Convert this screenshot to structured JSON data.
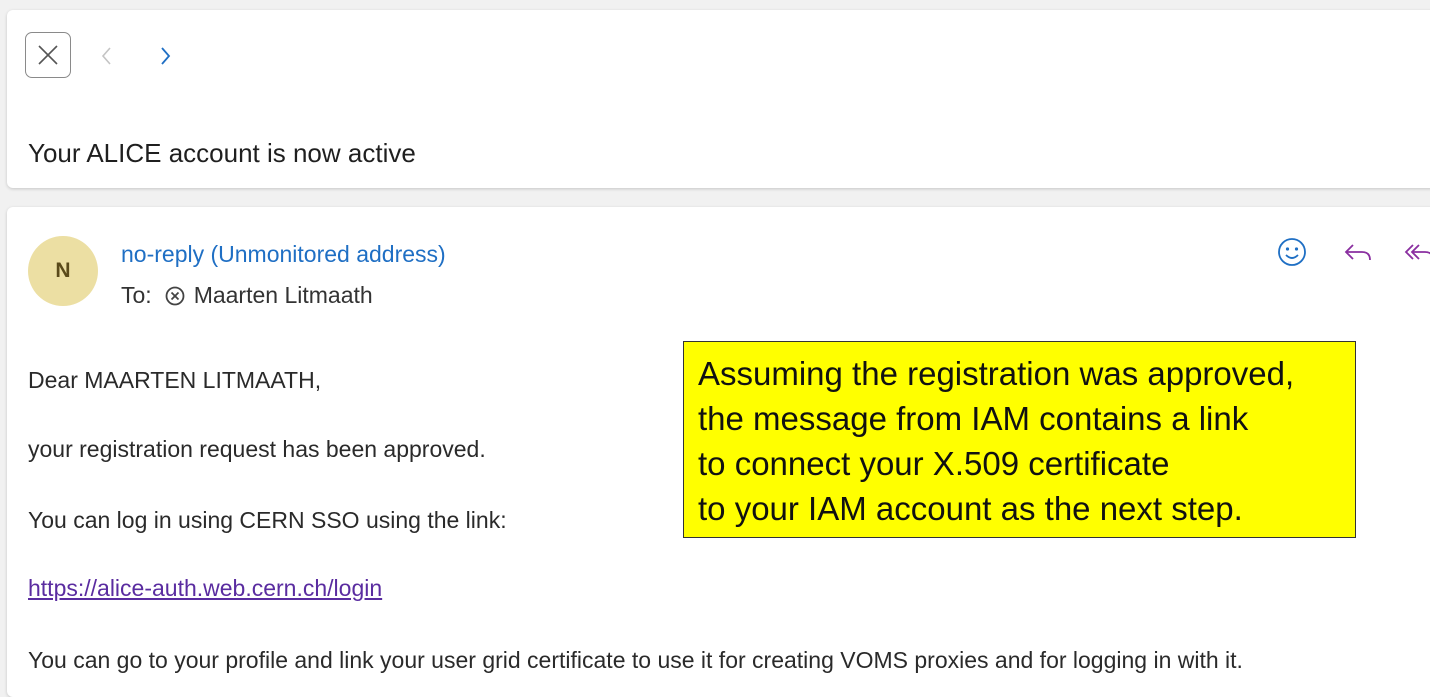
{
  "header": {
    "subject": "Your ALICE account is now active"
  },
  "message": {
    "avatar_initial": "N",
    "sender": "no-reply (Unmonitored address)",
    "to_label": "To:",
    "recipient": "Maarten Litmaath",
    "body": {
      "greeting": "Dear MAARTEN LITMAATH,",
      "line1": "your registration request has been approved.",
      "line2": "You can log in using CERN SSO using the link:",
      "link": "https://alice-auth.web.cern.ch/login",
      "line3": "You can go to your profile and link your user grid certificate to use it for creating VOMS proxies and for logging in with it."
    }
  },
  "callout": {
    "lines": [
      "Assuming the registration was approved,",
      "the message from IAM contains a link",
      "to connect your X.509 certificate",
      "to your IAM account as the next step."
    ],
    "background": "#ffff00"
  },
  "icons": {
    "close": "close-icon",
    "prev": "chevron-left-icon",
    "next": "chevron-right-icon",
    "emoji": "smiley-icon",
    "reply": "reply-icon",
    "reply_all": "reply-all-icon",
    "remove_recipient": "remove-circle-icon"
  },
  "colors": {
    "accent_blue": "#1f6fc4",
    "reply_purple": "#8a2fa0",
    "link_purple": "#5a2ca0",
    "avatar_bg": "#ecdfa3"
  }
}
